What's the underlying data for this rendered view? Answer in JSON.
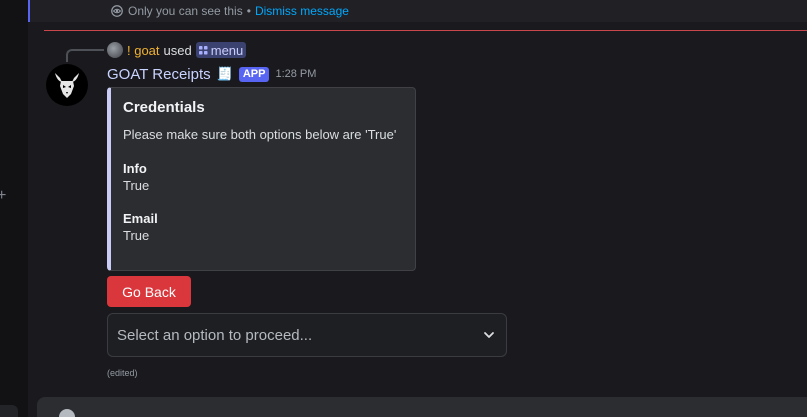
{
  "ephemeral_note": {
    "text": "Only you can see this",
    "separator": "•",
    "dismiss_label": "Dismiss message"
  },
  "reply": {
    "username": "! goat",
    "used_text": "used",
    "command": "menu"
  },
  "message": {
    "author": "GOAT Receipts",
    "author_emoji": "🧾",
    "badge": "APP",
    "timestamp": "1:28 PM",
    "edited_label": "(edited)"
  },
  "embed": {
    "accent_color": "#c9ccf5",
    "title": "Credentials",
    "description": "Please make sure both options below are 'True'",
    "fields": [
      {
        "name": "Info",
        "value": "True"
      },
      {
        "name": "Email",
        "value": "True"
      }
    ]
  },
  "components": {
    "go_back_label": "Go Back",
    "select_placeholder": "Select an option to proceed..."
  },
  "colors": {
    "danger": "#da373c",
    "brand": "#5865f2",
    "link": "#00a8fc",
    "reply_name": "#f0b232"
  },
  "icons": {
    "ephemeral": "eye-icon",
    "command": "slash-command-icon",
    "select": "chevron-down-icon",
    "avatar": "goat-skull-logo"
  }
}
